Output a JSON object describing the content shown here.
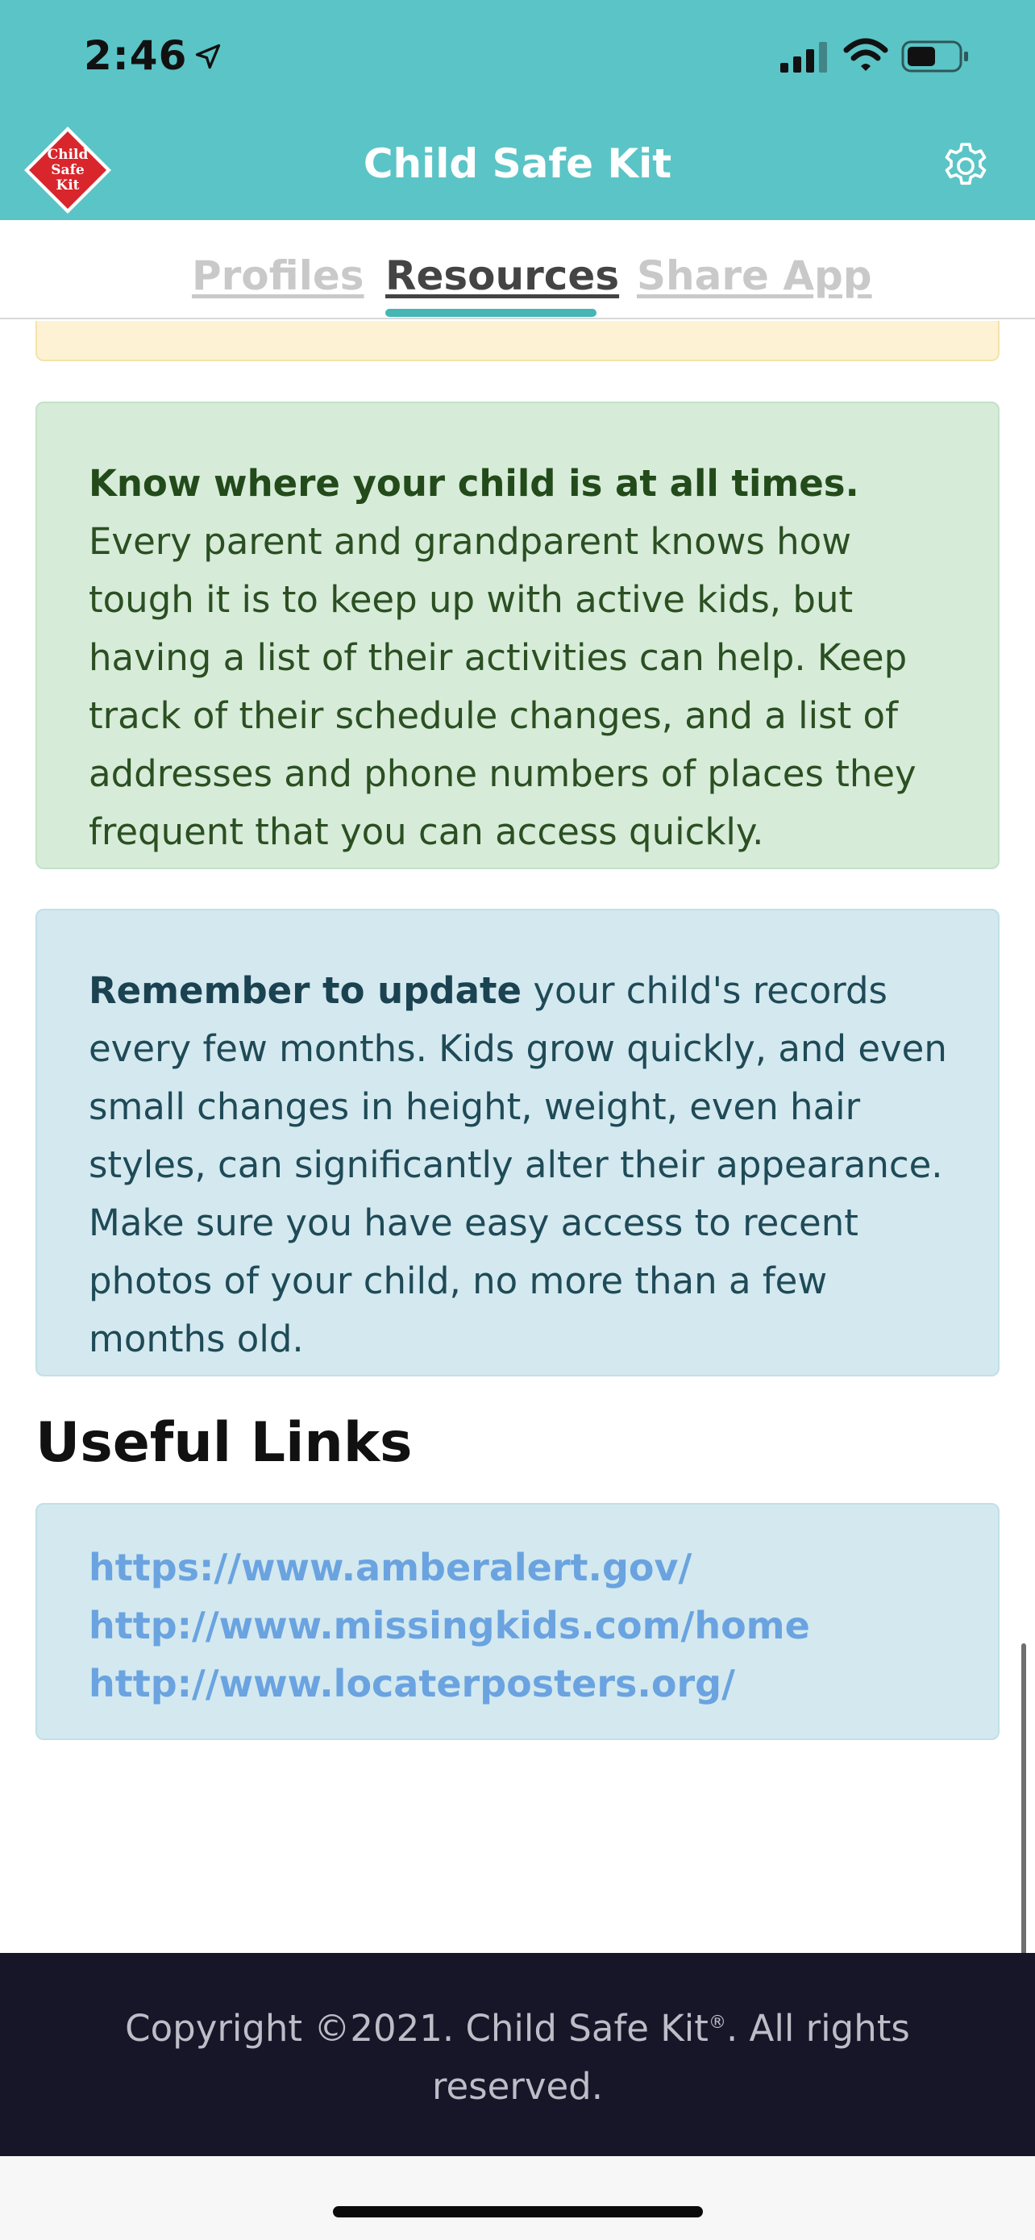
{
  "status_bar": {
    "time": "2:46"
  },
  "app": {
    "title": "Child Safe Kit",
    "logo_text": [
      "Child",
      "Safe",
      "Kit"
    ]
  },
  "tabs": [
    {
      "label": "Profiles",
      "active": false
    },
    {
      "label": "Resources",
      "active": true
    },
    {
      "label": "Share App",
      "active": false
    }
  ],
  "tips": [
    {
      "lead": "Know where your child is at all times.",
      "body": " Every parent and grandparent knows how tough it is to keep up with active kids, but having a list of their activities can help. Keep track of their schedule changes, and a list of addresses and phone numbers of places they frequent that you can access quickly."
    },
    {
      "lead": "Remember to update",
      "body": " your child's records every few months. Kids grow quickly, and even small changes in height, weight, even hair styles, can significantly alter their appearance. Make sure you have easy access to recent photos of your child, no more than a few months old."
    }
  ],
  "useful_links": {
    "title": "Useful Links",
    "links": [
      "https://www.amberalert.gov/",
      "http://www.missingkids.com/home",
      "http://www.locaterposters.org/"
    ]
  },
  "footer": {
    "copyright_prefix": "Copyright ©2021. Child Safe Kit",
    "registered_mark": "®",
    "copyright_suffix": ". All rights reserved."
  },
  "colors": {
    "header": "#5bc4c6",
    "active_tab_indicator": "#45b6b3",
    "tip_green_bg": "#d6ecd8",
    "tip_blue_bg": "#d3e9ef",
    "link": "#6aa3e0",
    "footer_bg": "#161628",
    "logo_red": "#d9262c"
  }
}
